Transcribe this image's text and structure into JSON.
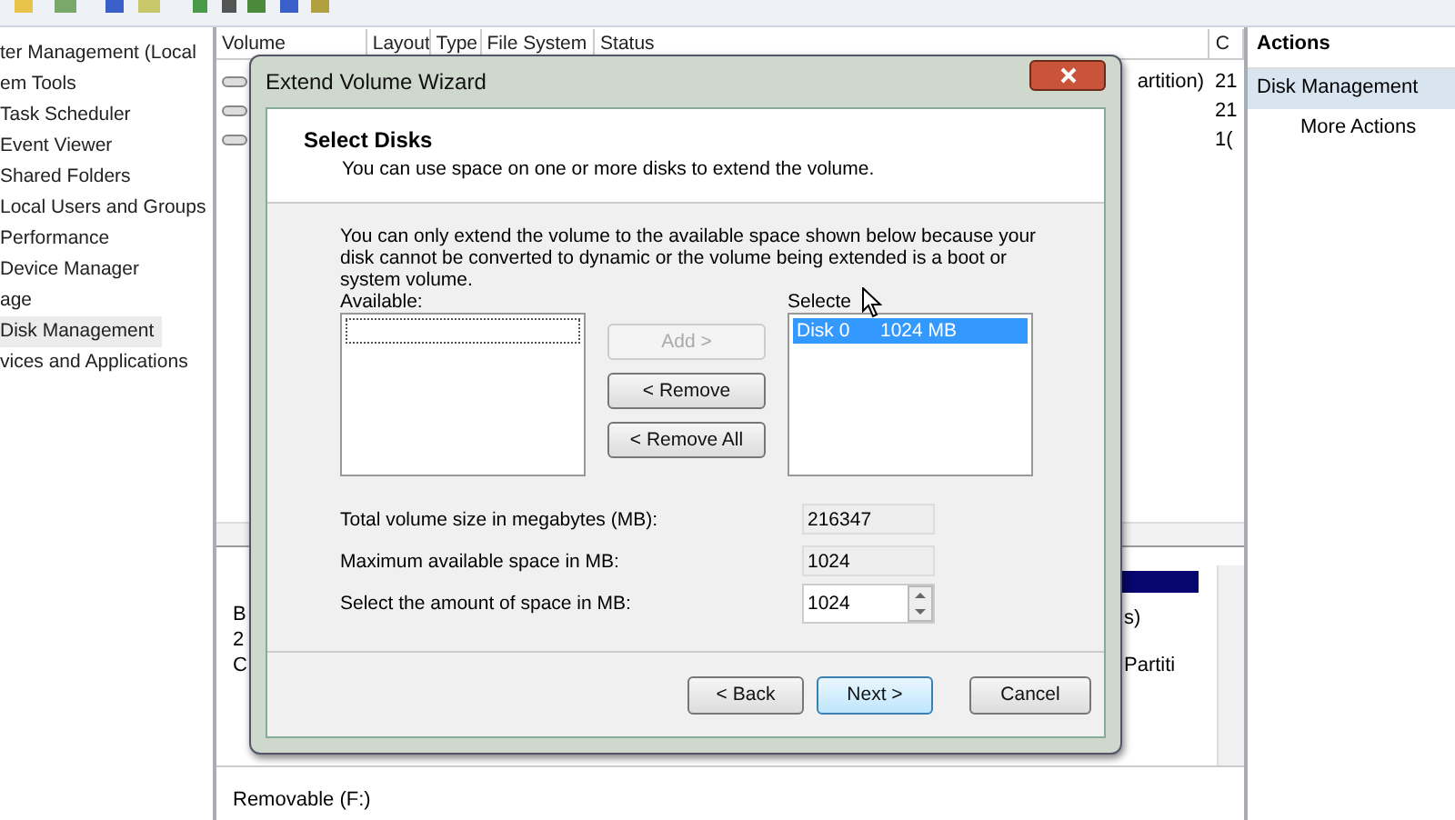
{
  "tree": [
    {
      "label": "ter Management (Local",
      "selected": false,
      "children": [
        {
          "label": "em Tools",
          "selected": false,
          "children": [
            {
              "label": "Task Scheduler",
              "selected": false
            },
            {
              "label": "Event Viewer",
              "selected": false
            },
            {
              "label": "Shared Folders",
              "selected": false
            },
            {
              "label": "Local Users and Groups",
              "selected": false
            },
            {
              "label": "Performance",
              "selected": false
            },
            {
              "label": "Device Manager",
              "selected": false
            }
          ]
        },
        {
          "label": "age",
          "selected": false,
          "children": [
            {
              "label": "Disk Management",
              "selected": true
            }
          ]
        },
        {
          "label": "vices and Applications",
          "selected": false
        }
      ]
    }
  ],
  "volume_table": {
    "columns": [
      "Volume",
      "Layout",
      "Type",
      "File System",
      "Status",
      "C"
    ],
    "rows": [
      {
        "status": "artition)",
        "capacity": "21"
      },
      {
        "capacity": "21"
      },
      {
        "capacity": "1("
      }
    ]
  },
  "disk_view": {
    "left_labels": [
      "B",
      "2",
      "C"
    ],
    "right_labels": [
      "s)",
      "Partiti"
    ],
    "removable": "Removable (F:)"
  },
  "actions": {
    "title": "Actions",
    "items": [
      {
        "label": "Disk Management",
        "kind": "header"
      },
      {
        "label": "More Actions",
        "kind": "link"
      }
    ]
  },
  "dialog": {
    "title": "Extend Volume Wizard",
    "heading": "Select Disks",
    "subtitle": "You can use space on one or more disks to extend the volume.",
    "note": "You can only extend the volume to the available space shown below because your disk cannot be converted to dynamic or the volume being extended is a boot or system volume.",
    "available_label": "Available:",
    "selected_label": "Selecte",
    "selected_disks": [
      {
        "disk": "Disk 0",
        "size": "1024 MB",
        "selected": true
      }
    ],
    "move_buttons": [
      {
        "label": "Add >",
        "disabled": true
      },
      {
        "label": "< Remove",
        "disabled": false
      },
      {
        "label": "< Remove All",
        "disabled": false
      }
    ],
    "fields": [
      {
        "label": "Total volume size in megabytes (MB):",
        "value": "216347",
        "kind": "readonly"
      },
      {
        "label": "Maximum available space in MB:",
        "value": "1024",
        "kind": "readonly"
      },
      {
        "label": "Select the amount of space in MB:",
        "value": "1024",
        "kind": "spinner"
      }
    ],
    "nav_buttons": [
      {
        "label": "< Back",
        "default": false
      },
      {
        "label": "Next >",
        "default": true
      },
      {
        "label": "Cancel",
        "default": false
      }
    ]
  }
}
